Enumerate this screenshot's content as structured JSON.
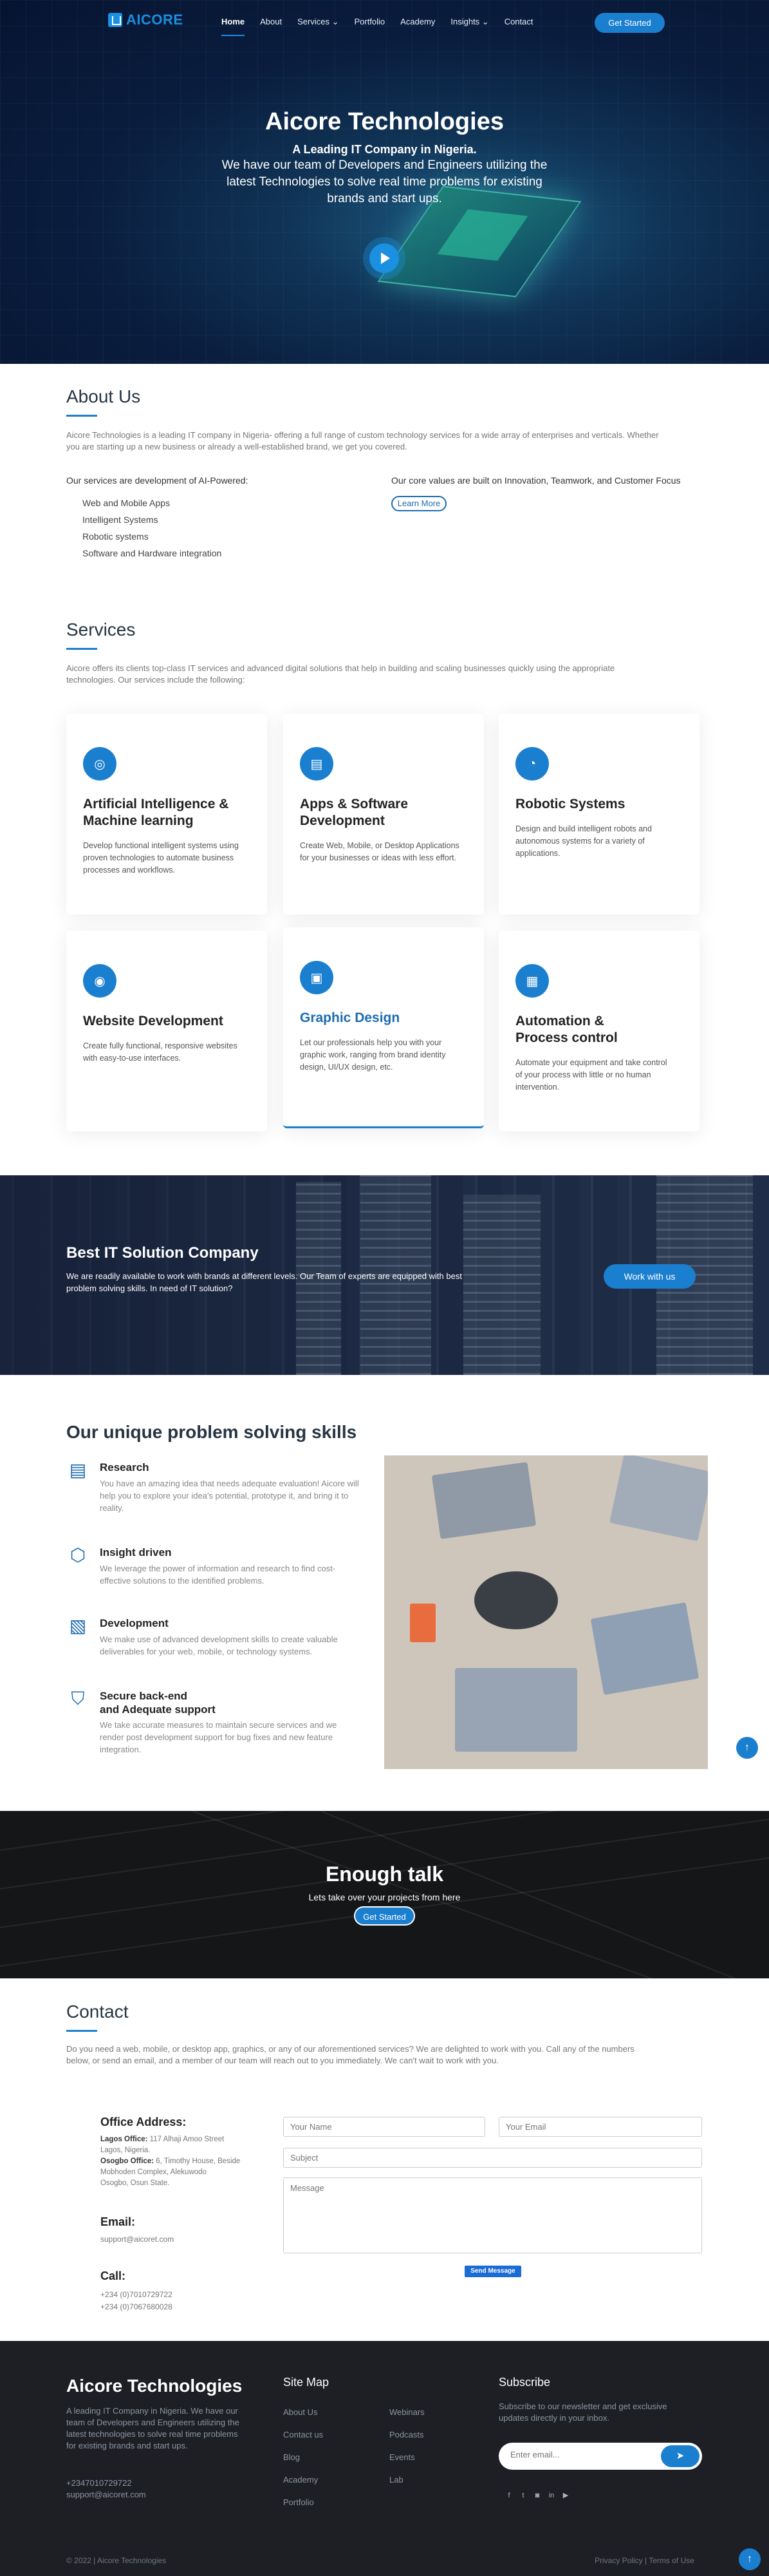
{
  "brand": {
    "logo_text": "AICORE",
    "accent": "#1b7fd0"
  },
  "nav": {
    "items": [
      {
        "label": "Home",
        "active": true
      },
      {
        "label": "About"
      },
      {
        "label": "Services ⌄"
      },
      {
        "label": "Portfolio"
      },
      {
        "label": "Academy"
      },
      {
        "label": "Insights ⌄"
      },
      {
        "label": "Contact"
      }
    ],
    "cta": "Get Started"
  },
  "hero": {
    "title": "Aicore Technologies",
    "subtitle": "A Leading IT Company in Nigeria.",
    "line1": "We have our team of Developers and Engineers utilizing the",
    "line2": "latest Technologies to solve real time problems for existing",
    "line3": "brands and start ups."
  },
  "about": {
    "heading": "About Us",
    "p1": "Aicore Technologies is a leading IT company in Nigeria- offering a full range of custom technology services for a wide array of enterprises and verticals. Whether",
    "p2": "you are starting up a new business or already a well-established brand, we get you covered.",
    "left_title": "Our services are development of AI-Powered:",
    "items": [
      "Web and Mobile Apps",
      "Intelligent Systems",
      "Robotic systems",
      "Software and Hardware integration"
    ],
    "right_title": "Our core values are built on Innovation, Teamwork, and Customer Focus",
    "learn_more": "Learn More"
  },
  "services": {
    "heading": "Services",
    "p1": "Aicore offers its clients top-class IT services and advanced digital solutions that help in building and scaling businesses quickly using the appropriate",
    "p2": "technologies. Our services include the following:",
    "cards": [
      {
        "icon": "brain-icon",
        "glyph": "◎",
        "t1": "Artificial Intelligence &",
        "t2": "Machine learning",
        "d": [
          "Develop functional intelligent systems using",
          "proven technologies to automate business",
          "processes and workflows."
        ]
      },
      {
        "icon": "document-icon",
        "glyph": "▤",
        "t1": "Apps & Software",
        "t2": "Development",
        "d": [
          "Create Web, Mobile, or Desktop Applications",
          "for your businesses or ideas with less effort."
        ]
      },
      {
        "icon": "robot-icon",
        "glyph": "◔",
        "t1": "Robotic Systems",
        "t2": "",
        "d": [
          "Design and build intelligent robots and",
          "autonomous systems for a variety of",
          "applications."
        ]
      },
      {
        "icon": "globe-icon",
        "glyph": "◉",
        "t1": "Website Development",
        "t2": "",
        "d": [
          "Create fully functional, responsive websites",
          "with easy-to-use interfaces."
        ]
      },
      {
        "icon": "monitor-icon",
        "glyph": "▣",
        "t1": "Graphic Design",
        "t2": "",
        "d": [
          "Let our professionals help you with your",
          "graphic work, ranging from brand identity",
          "design, UI/UX design, etc."
        ]
      },
      {
        "icon": "building-icon",
        "glyph": "▦",
        "t1": "Automation &",
        "t2": "Process control",
        "d": [
          "Automate your equipment and take control",
          "of your process with little or no human",
          "intervention."
        ]
      }
    ]
  },
  "cta": {
    "title": "Best IT Solution Company",
    "l1": "We are readily available to work with brands at different levels. Our Team of experts are equipped with best",
    "l2": "problem solving skills. In need of IT solution?",
    "button": "Work with us"
  },
  "skills": {
    "heading": "Our unique problem solving skills",
    "items": [
      {
        "icon": "research-icon",
        "glyph": "▤",
        "t1": "Research",
        "t2": "",
        "d": [
          "You have an amazing idea that needs adequate evaluation! Aicore will",
          "help you to explore your idea's potential, prototype it, and bring it to",
          "reality."
        ]
      },
      {
        "icon": "hexagon-icon",
        "glyph": "⬡",
        "t1": "Insight driven",
        "t2": "",
        "d": [
          "We leverage the power of information and research to find cost-",
          "effective solutions to the identified problems."
        ]
      },
      {
        "icon": "images-icon",
        "glyph": "▧",
        "t1": "Development",
        "t2": "",
        "d": [
          "We make use of advanced development skills to create valuable",
          "deliverables for your web, mobile, or technology systems."
        ]
      },
      {
        "icon": "shield-icon",
        "glyph": "⛉",
        "t1": "Secure back-end",
        "t2": "and Adequate support",
        "d": [
          "We take accurate measures to maintain secure services and we",
          "render post development support for bug fixes and new feature",
          "integration."
        ]
      }
    ]
  },
  "talk": {
    "title": "Enough talk",
    "sub": "Lets take over your projects from here",
    "button": "Get Started"
  },
  "contact": {
    "heading": "Contact",
    "p1": "Do you need a web, mobile, or desktop app, graphics, or any of our aforementioned services? We are delighted to work with you. Call any of the numbers",
    "p2": "below, or send an email, and a member of our team will reach out to you immediately. We can't wait to work with you.",
    "office_title": "Office Address:",
    "lagos_label": "Lagos Office:",
    "lagos_1": " 117 Alhaji Amoo Street",
    "lagos_2": "Lagos, Nigeria.",
    "osogbo_label": "Osogbo Office:",
    "osogbo_1": " 6, Timothy House, Beside",
    "osogbo_2": "Mobhoden Complex, Alekuwodo",
    "osogbo_3": "Osogbo, Osun State.",
    "email_title": "Email:",
    "email": "support@aicoret.com",
    "call_title": "Call:",
    "phone1": "+234 (0)7010729722",
    "phone2": "+234 (0)7067680028",
    "ph_name": "Your Name",
    "ph_email": "Your Email",
    "ph_subject": "Subject",
    "ph_message": "Message",
    "send": "Send Message"
  },
  "footer": {
    "title": "Aicore Technologies",
    "desc": [
      "A leading IT Company in Nigeria. We have our",
      "team of Developers and Engineers utilizing the",
      "latest technologies to solve real time problems",
      "for existing brands and start ups."
    ],
    "phone": "+2347010729722",
    "email": "support@aicoret.com",
    "sitemap_title": "Site Map",
    "col1": [
      "About Us",
      "Contact us",
      "Blog",
      "Academy",
      "Portfolio"
    ],
    "col2": [
      "Webinars",
      "Podcasts",
      "Events",
      "Lab"
    ],
    "subscribe_title": "Subscribe",
    "subscribe_text": [
      "Subscribe to our newsletter and get exclusive",
      "updates directly in your inbox."
    ],
    "ph_newsletter": "Enter email...",
    "copyright": "© 2022 | Aicore Technologies",
    "legal": "Privacy Policy | Terms of Use"
  }
}
